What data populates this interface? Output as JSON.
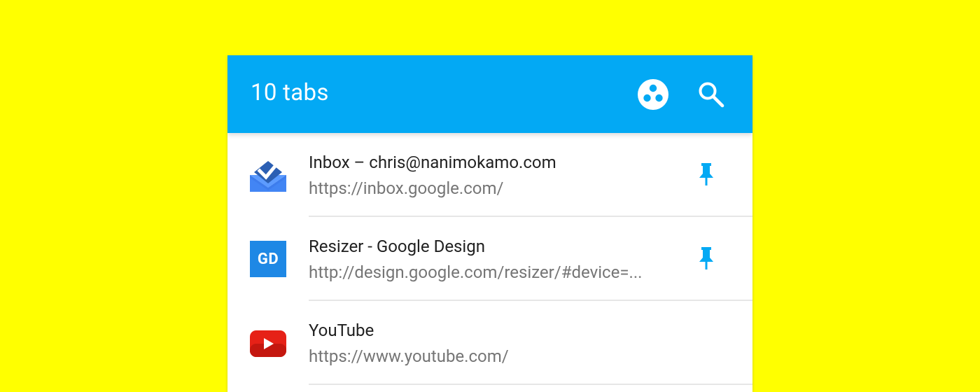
{
  "appbar": {
    "title": "10 tabs",
    "color": "#03a9f4",
    "actions": [
      {
        "icon": "group-icon"
      },
      {
        "icon": "search-icon"
      }
    ]
  },
  "tabs": [
    {
      "title": "Inbox – chris@nanimokamo.com",
      "url": "https://inbox.google.com/",
      "favicon": "inbox-favicon",
      "pinned": true
    },
    {
      "title": "Resizer - Google Design",
      "url": "http://design.google.com/resizer/#device=...",
      "favicon": "google-design-favicon",
      "favicon_text": "GD",
      "pinned": true
    },
    {
      "title": "YouTube",
      "url": "https://www.youtube.com/",
      "favicon": "youtube-favicon",
      "pinned": false
    }
  ],
  "colors": {
    "background": "#ffff00",
    "accent": "#03a9f4"
  }
}
